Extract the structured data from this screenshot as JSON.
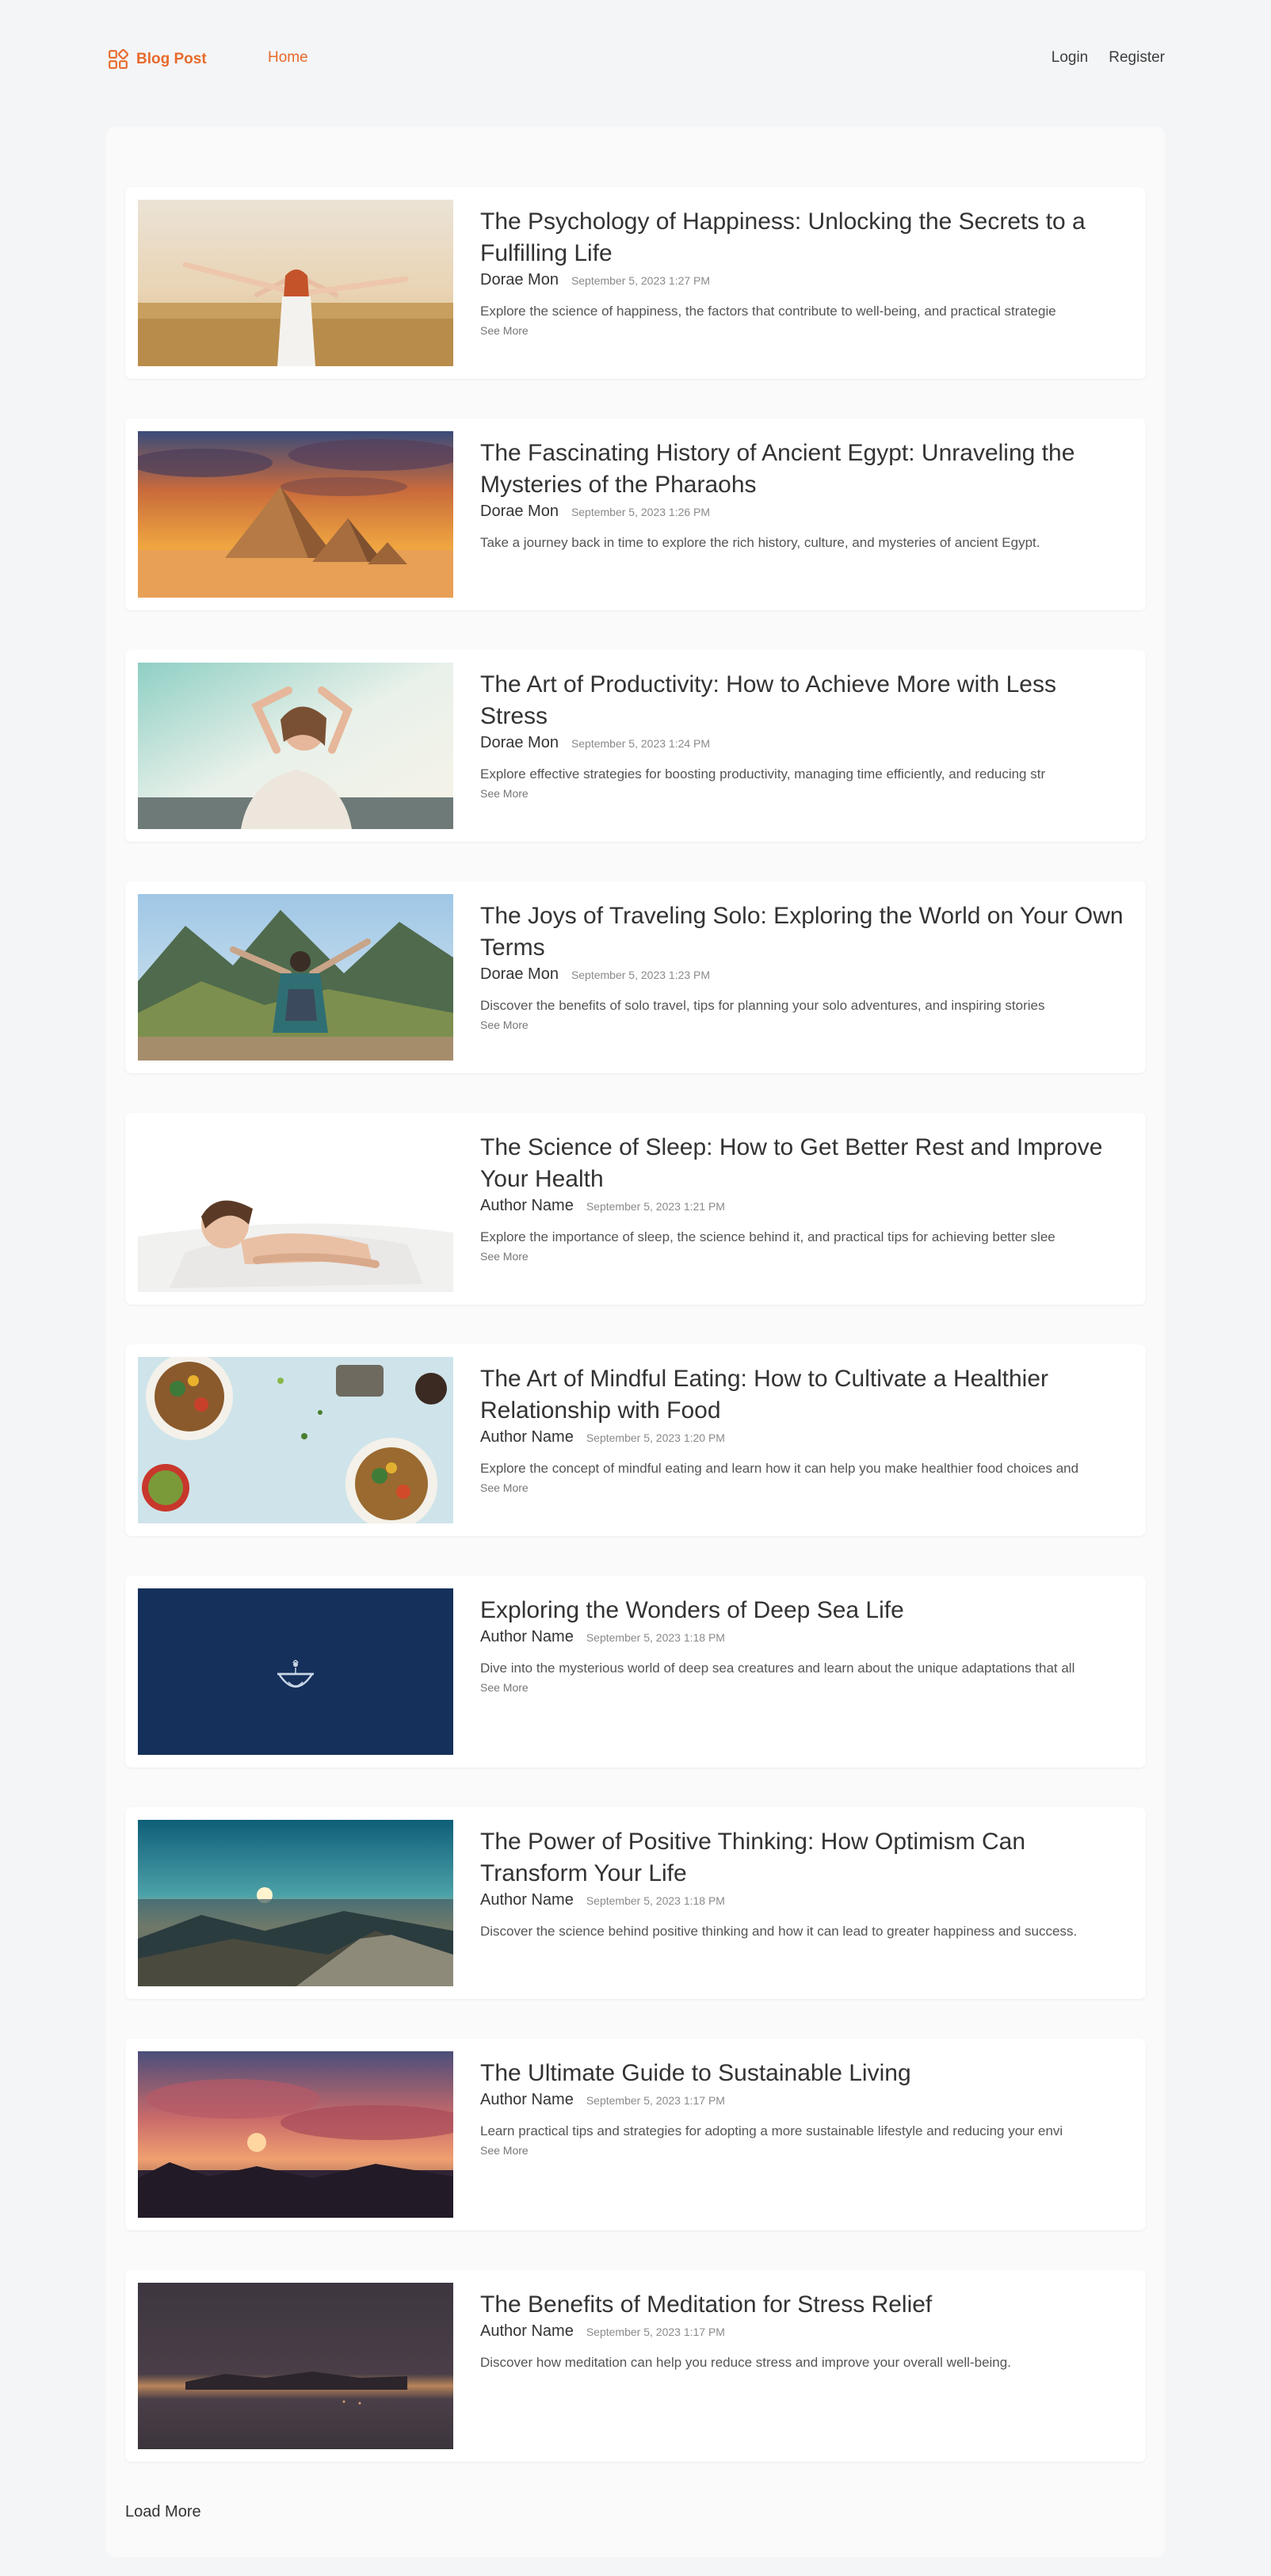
{
  "header": {
    "brand": "Blog Post",
    "nav": {
      "home": "Home",
      "login": "Login",
      "register": "Register"
    },
    "accent_color": "#e86a2b"
  },
  "posts": [
    {
      "title": "The Psychology of Happiness: Unlocking the Secrets to a Fulfilling Life",
      "author": "Dorae Mon",
      "date": "September 5, 2023 1:27 PM",
      "excerpt": "Explore the science of happiness, the factors that contribute to well-being, and practical strategie",
      "see_more": "See More",
      "image": "woman-arms-raised-wheat-field"
    },
    {
      "title": "The Fascinating History of Ancient Egypt: Unraveling the Mysteries of the Pharaohs",
      "author": "Dorae Mon",
      "date": "September 5, 2023 1:26 PM",
      "excerpt": "Take a journey back in time to explore the rich history, culture, and mysteries of ancient Egypt.",
      "see_more": "",
      "image": "pyramids-sunset"
    },
    {
      "title": "The Art of Productivity: How to Achieve More with Less Stress",
      "author": "Dorae Mon",
      "date": "September 5, 2023 1:24 PM",
      "excerpt": "Explore effective strategies for boosting productivity, managing time efficiently, and reducing str",
      "see_more": "See More",
      "image": "woman-hands-on-head-relaxing"
    },
    {
      "title": "The Joys of Traveling Solo: Exploring the World on Your Own Terms",
      "author": "Dorae Mon",
      "date": "September 5, 2023 1:23 PM",
      "excerpt": "Discover the benefits of solo travel, tips for planning your solo adventures, and inspiring stories",
      "see_more": "See More",
      "image": "traveler-machu-picchu"
    },
    {
      "title": "The Science of Sleep: How to Get Better Rest and Improve Your Health",
      "author": "Author Name",
      "date": "September 5, 2023 1:21 PM",
      "excerpt": "Explore the importance of sleep, the science behind it, and practical tips for achieving better slee",
      "see_more": "See More",
      "image": "woman-sleeping-pillow"
    },
    {
      "title": "The Art of Mindful Eating: How to Cultivate a Healthier Relationship with Food",
      "author": "Author Name",
      "date": "September 5, 2023 1:20 PM",
      "excerpt": "Explore the concept of mindful eating and learn how it can help you make healthier food choices and",
      "see_more": "See More",
      "image": "salad-bowls-table"
    },
    {
      "title": "Exploring the Wonders of Deep Sea Life",
      "author": "Author Name",
      "date": "September 5, 2023 1:18 PM",
      "excerpt": "Dive into the mysterious world of deep sea creatures and learn about the unique adaptations that all",
      "see_more": "See More",
      "image": "deep-sea-logo-navy"
    },
    {
      "title": "The Power of Positive Thinking: How Optimism Can Transform Your Life",
      "author": "Author Name",
      "date": "September 5, 2023 1:18 PM",
      "excerpt": "Discover the science behind positive thinking and how it can lead to greater happiness and success.",
      "see_more": "",
      "image": "mountain-sunrise"
    },
    {
      "title": "The Ultimate Guide to Sustainable Living",
      "author": "Author Name",
      "date": "September 5, 2023 1:17 PM",
      "excerpt": "Learn practical tips and strategies for adopting a more sustainable lifestyle and reducing your envi",
      "see_more": "See More",
      "image": "red-sky-sunset-forest"
    },
    {
      "title": "The Benefits of Meditation for Stress Relief",
      "author": "Author Name",
      "date": "September 5, 2023 1:17 PM",
      "excerpt": "Discover how meditation can help you reduce stress and improve your overall well-being.",
      "see_more": "",
      "image": "dusk-horizon"
    }
  ],
  "load_more": "Load More"
}
